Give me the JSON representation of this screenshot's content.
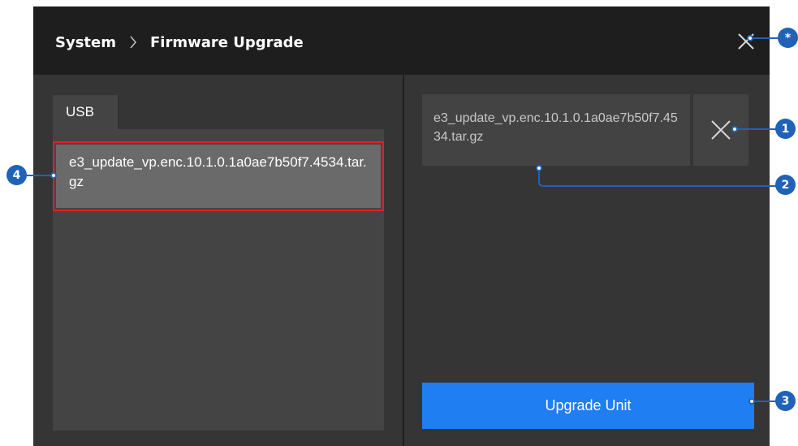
{
  "header": {
    "breadcrumb": [
      "System",
      "Firmware Upgrade"
    ],
    "separator_icon": "chevron-right-icon",
    "close_icon": "close-icon"
  },
  "left_panel": {
    "tab_label": "USB",
    "usb_files": [
      "e3_update_vp.enc.10.1.0.1a0ae7b50f7.4534.tar.gz"
    ]
  },
  "right_panel": {
    "selected_file": "e3_update_vp.enc.10.1.0.1a0ae7b50f7.4534.tar.gz",
    "clear_icon": "close-icon",
    "upgrade_button": "Upgrade Unit"
  },
  "callouts": [
    "*",
    "1",
    "2",
    "3",
    "4"
  ],
  "colors": {
    "header_bg": "#1e1e1e",
    "panel_bg": "#353535",
    "accent_blue": "#1e7ef2",
    "callout_blue": "#1f62b8",
    "selection_border": "#e0202c"
  }
}
